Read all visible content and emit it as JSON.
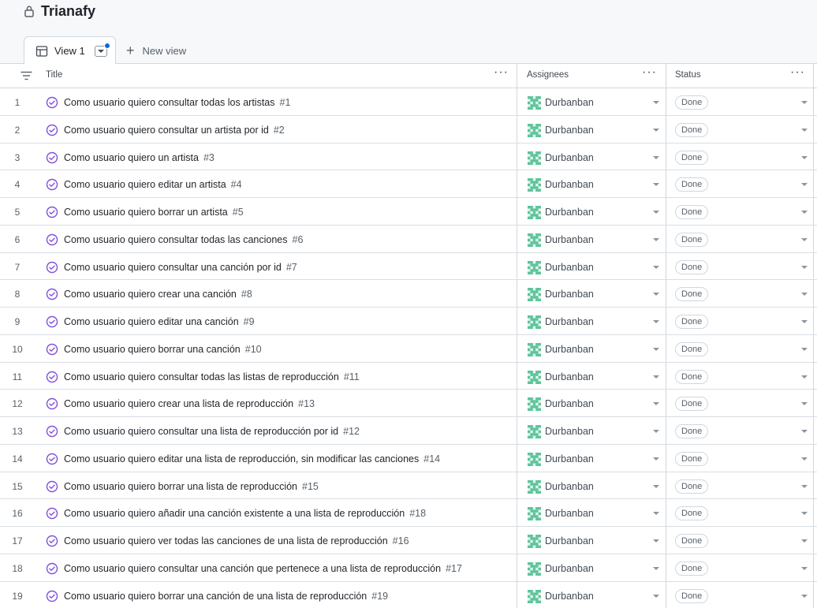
{
  "project": {
    "title": "Trianafy",
    "lock_icon": "lock-icon"
  },
  "views": {
    "active_tab_label": "View 1",
    "new_view_label": "New view"
  },
  "table": {
    "columns": {
      "title": "Title",
      "assignees": "Assignees",
      "status": "Status"
    },
    "rows": [
      {
        "num": "1",
        "title": "Como usuario quiero consultar todas los artistas",
        "issue": "#1",
        "assignee": "Durbanban",
        "status": "Done"
      },
      {
        "num": "2",
        "title": "Como usuario quiero consultar un artista por id",
        "issue": "#2",
        "assignee": "Durbanban",
        "status": "Done"
      },
      {
        "num": "3",
        "title": "Como usuario quiero un artista",
        "issue": "#3",
        "assignee": "Durbanban",
        "status": "Done"
      },
      {
        "num": "4",
        "title": "Como usuario quiero editar un artista",
        "issue": "#4",
        "assignee": "Durbanban",
        "status": "Done"
      },
      {
        "num": "5",
        "title": "Como usuario quiero borrar un artista",
        "issue": "#5",
        "assignee": "Durbanban",
        "status": "Done"
      },
      {
        "num": "6",
        "title": "Como usuario quiero consultar todas las canciones",
        "issue": "#6",
        "assignee": "Durbanban",
        "status": "Done"
      },
      {
        "num": "7",
        "title": "Como usuario quiero consultar una canción por id",
        "issue": "#7",
        "assignee": "Durbanban",
        "status": "Done"
      },
      {
        "num": "8",
        "title": "Como usuario quiero crear una canción",
        "issue": "#8",
        "assignee": "Durbanban",
        "status": "Done"
      },
      {
        "num": "9",
        "title": "Como usuario quiero editar una canción",
        "issue": "#9",
        "assignee": "Durbanban",
        "status": "Done"
      },
      {
        "num": "10",
        "title": "Como usuario quiero borrar una canción",
        "issue": "#10",
        "assignee": "Durbanban",
        "status": "Done"
      },
      {
        "num": "11",
        "title": "Como usuario quiero consultar todas las listas de reproducción",
        "issue": "#11",
        "assignee": "Durbanban",
        "status": "Done"
      },
      {
        "num": "12",
        "title": "Como usuario quiero crear una lista de reproducción",
        "issue": "#13",
        "assignee": "Durbanban",
        "status": "Done"
      },
      {
        "num": "13",
        "title": "Como usuario quiero consultar una lista de reproducción por id",
        "issue": "#12",
        "assignee": "Durbanban",
        "status": "Done"
      },
      {
        "num": "14",
        "title": "Como usuario quiero editar una lista de reproducción, sin modificar las canciones",
        "issue": "#14",
        "assignee": "Durbanban",
        "status": "Done"
      },
      {
        "num": "15",
        "title": "Como usuario quiero borrar una lista de reproducción",
        "issue": "#15",
        "assignee": "Durbanban",
        "status": "Done"
      },
      {
        "num": "16",
        "title": "Como usuario quiero añadir una canción existente a una lista de reproducción",
        "issue": "#18",
        "assignee": "Durbanban",
        "status": "Done"
      },
      {
        "num": "17",
        "title": "Como usuario quiero ver todas las canciones de una lista de reproducción",
        "issue": "#16",
        "assignee": "Durbanban",
        "status": "Done"
      },
      {
        "num": "18",
        "title": "Como usuario quiero consultar una canción que pertenece a una lista de reproducción",
        "issue": "#17",
        "assignee": "Durbanban",
        "status": "Done"
      },
      {
        "num": "19",
        "title": "Como usuario quiero borrar una canción de una lista de reproducción",
        "issue": "#19",
        "assignee": "Durbanban",
        "status": "Done"
      }
    ]
  },
  "colors": {
    "accent": "#0969da",
    "closed_issue": "#8250df",
    "avatar": "#5ec49b"
  }
}
